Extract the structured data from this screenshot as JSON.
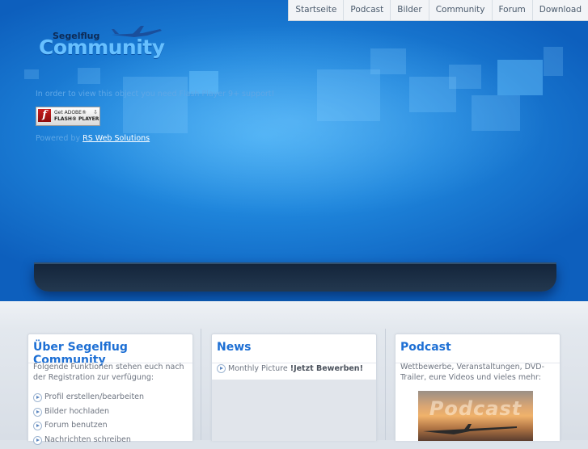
{
  "nav": {
    "items": [
      "Startseite",
      "Podcast",
      "Bilder",
      "Community",
      "Forum",
      "Download"
    ]
  },
  "logo": {
    "top": "Segelflug",
    "main": "Community"
  },
  "flash": {
    "message": "In order to view this object you need Flash Player 9+ support!",
    "badge_line1": "Get ADOBE®",
    "badge_line2": "FLASH® PLAYER",
    "badge_logo": "f",
    "badge_arrow": "⇩",
    "powered_prefix": "Powered by ",
    "powered_link": "RS Web Solutions"
  },
  "about": {
    "title": "Über Segelflug Community",
    "desc": "Folgende Funktionen stehen euch nach der Registration zur verfügung:",
    "items": [
      "Profil erstellen/bearbeiten",
      "Bilder hochladen",
      "Forum benutzen",
      "Nachrichten schreiben"
    ]
  },
  "news": {
    "title": "News",
    "item_prefix": "Monthly Picture ",
    "item_bold": "!Jetzt Bewerben!"
  },
  "podcast": {
    "title": "Podcast",
    "desc": "Wettbewerbe, Veranstaltungen, DVD-Trailer, eure Videos und vieles mehr:",
    "image_text": "Podcast"
  },
  "colors": {
    "accent": "#1d6fd4",
    "hero": "#1f86dc",
    "stage": "#1a2d44"
  },
  "icons": [
    "plane-icon",
    "flash-player-icon",
    "bullet-arrow-icon",
    "glider-icon"
  ]
}
